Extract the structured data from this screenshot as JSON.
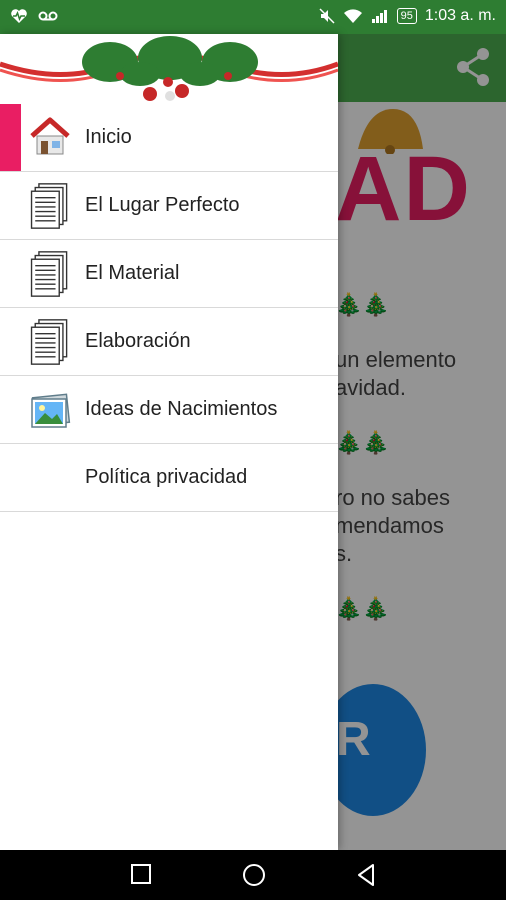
{
  "status_bar": {
    "time": "1:03 a. m.",
    "battery": "95"
  },
  "background": {
    "big_word": "AD",
    "trees_1": "🎄🎄",
    "trees_2": "🎄🎄",
    "trees_3": "🎄🎄",
    "text_1_line1": "un elemento",
    "text_1_line2": "avidad.",
    "text_2_line1": "ro no sabes",
    "text_2_line2": "mendamos",
    "text_2_line3": "s.",
    "button_fragment": "R"
  },
  "drawer": {
    "items": [
      {
        "label": "Inicio",
        "icon": "home-icon"
      },
      {
        "label": "El Lugar Perfecto",
        "icon": "document-stack-icon"
      },
      {
        "label": "El Material",
        "icon": "document-stack-icon"
      },
      {
        "label": "Elaboración",
        "icon": "document-stack-icon"
      },
      {
        "label": "Ideas de Nacimientos",
        "icon": "picture-icon"
      },
      {
        "label": "Política privacidad",
        "icon": ""
      }
    ]
  },
  "colors": {
    "status_bar": "#2e7d32",
    "app_bar": "#4caf50",
    "accent": "#e91e63"
  }
}
